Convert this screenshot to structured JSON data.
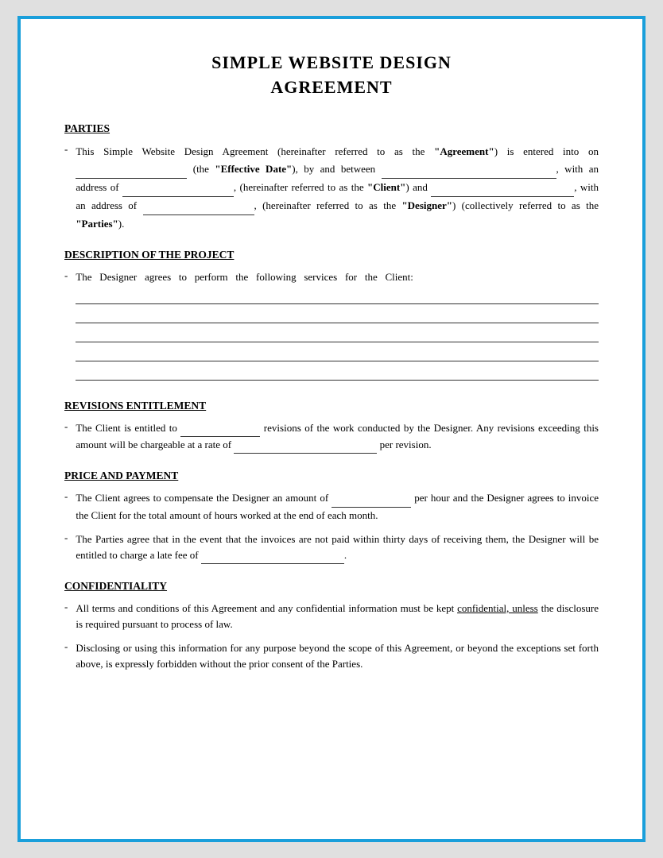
{
  "document": {
    "title_line1": "SIMPLE WEBSITE DESIGN",
    "title_line2": "AGREEMENT",
    "sections": {
      "parties": {
        "heading": "PARTIES",
        "text": "This Simple Website Design Agreement (hereinafter referred to as the",
        "agreement_label": "“Agreement”",
        "is_entered": "is entered into on",
        "effective_date_label": "“Effective Date”",
        "by_between": "), by and between",
        "with_address_of": ", with an address of",
        "hereinafter_referred": ", (hereinafter referred to as the",
        "client_label": "“Client”",
        "and": ") and",
        "with_address_of2": ", with an address of",
        "hereinafter_referred2": ", (hereinafter referred to as the",
        "designer_label": "“Designer”",
        "collectively": ") (collectively referred to as the",
        "parties_label": "“Parties”",
        "end": ")."
      },
      "description": {
        "heading": "DESCRIPTION OF THE PROJECT",
        "text": "The Designer agrees to perform the following services for the Client:"
      },
      "revisions": {
        "heading": "REVISIONS ENTITLEMENT",
        "text1": "The Client is entitled to",
        "text2": "revisions of the work conducted by the Designer. Any revisions exceeding this amount will be chargeable at a rate of",
        "text3": "per revision."
      },
      "price": {
        "heading": "PRICE AND PAYMENT",
        "bullet1_text": "The Client agrees to compensate the Designer an amount of",
        "bullet1_text2": "per hour and the Designer agrees to invoice the Client for the total amount of hours worked at the end of each month.",
        "bullet2_text": "The Parties agree that in the event that the invoices are not paid within thirty days of receiving them, the Designer will be entitled to charge a late fee of",
        "bullet2_end": "."
      },
      "confidentiality": {
        "heading": "CONFIDENTIALITY",
        "bullet1_text": "All terms and conditions of this Agreement and any confidential information must be kept",
        "bullet1_underline": "confidential, unless",
        "bullet1_text2": "the disclosure is required pursuant to process of law.",
        "bullet2_text": "Disclosing or using this information for any purpose beyond the scope of this Agreement, or beyond the exceptions set forth above, is expressly forbidden without the prior consent of the Parties."
      }
    }
  }
}
